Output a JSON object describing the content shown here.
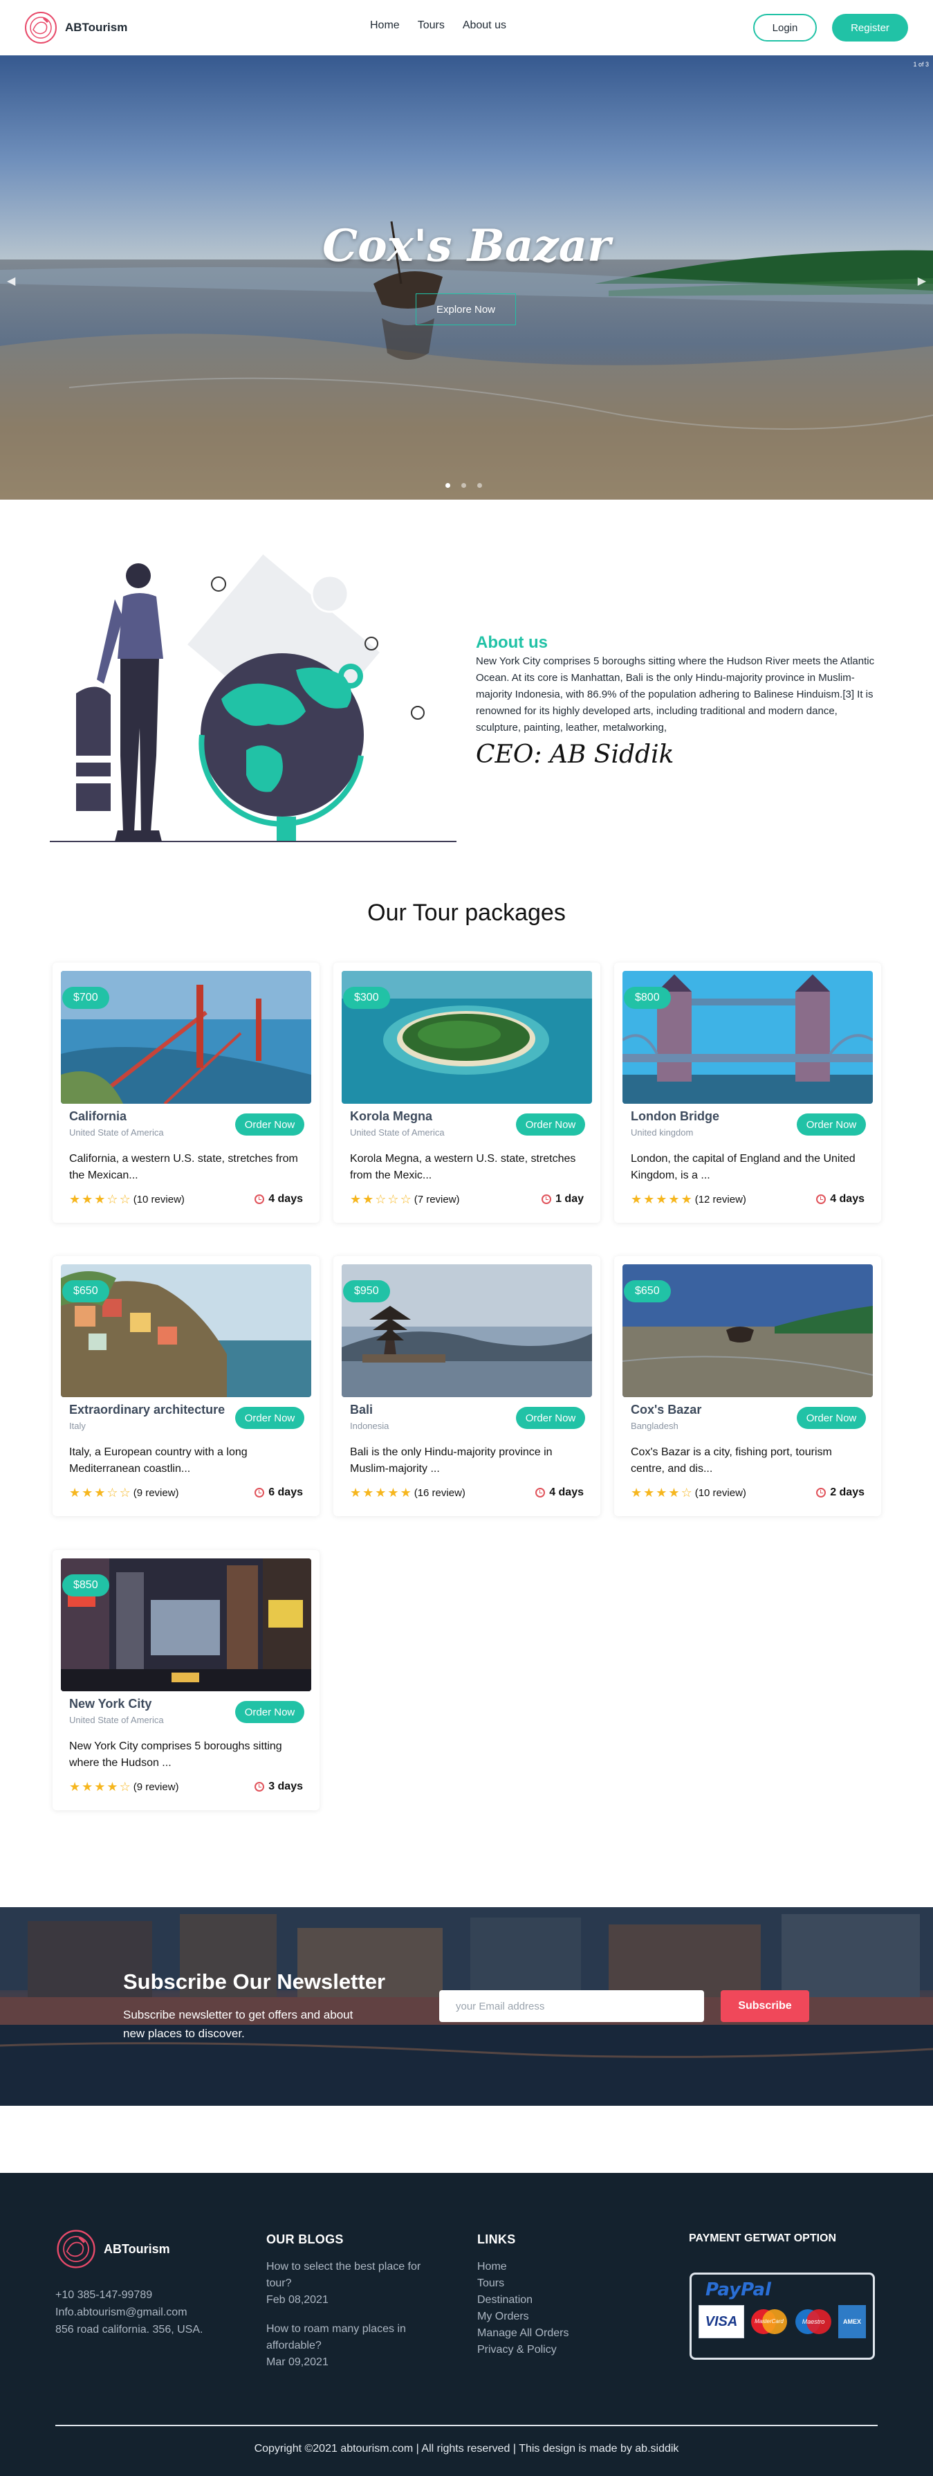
{
  "nav": {
    "brand": "ABTourism",
    "links": [
      "Home",
      "Tours",
      "About us"
    ],
    "login": "Login",
    "register": "Register",
    "colors": {
      "accent": "#21c2a6",
      "brand_logo": "#e84a6a"
    }
  },
  "hero": {
    "counter": "1 of 3",
    "title": "Cox's Bazar",
    "button": "Explore Now",
    "prev_icon": "chevron-left-icon",
    "next_icon": "chevron-right-icon",
    "slides": 3,
    "active_slide": 1
  },
  "about": {
    "title": "About us",
    "text": "New York City comprises 5 boroughs sitting where the Hudson River meets the Atlantic Ocean. At its core is Manhattan, Bali is the only Hindu-majority province in Muslim-majority Indonesia, with 86.9% of the population adhering to Balinese Hinduism.[3] It is renowned for its highly developed arts, including traditional and modern dance, sculpture, painting, leather, metalworking,",
    "ceo": "CEO: AB Siddik"
  },
  "packages": {
    "title": "Our Tour packages",
    "order_label": "Order Now",
    "items": [
      {
        "price": "$700",
        "name": "California",
        "country": "United State of America",
        "desc": "California, a western U.S. state, stretches from the Mexican...",
        "rating": 3,
        "reviews": "(10 review)",
        "days": "4 days",
        "scene": "golden-gate-bridge"
      },
      {
        "price": "$300",
        "name": "Korola Megna",
        "country": "United State of America",
        "desc": "Korola Megna, a western U.S. state, stretches from the Mexic...",
        "rating": 2,
        "reviews": "(7 review)",
        "days": "1 day",
        "scene": "island"
      },
      {
        "price": "$800",
        "name": "London Bridge",
        "country": "United kingdom",
        "desc": "London, the capital of England and the United Kingdom, is a ...",
        "rating": 5,
        "reviews": "(12 review)",
        "days": "4 days",
        "scene": "tower-bridge"
      },
      {
        "price": "$650",
        "name": "Extraordinary architecture",
        "country": "Italy",
        "desc": "Italy, a European country with a long Mediterranean coastlin...",
        "rating": 3,
        "reviews": "(9 review)",
        "days": "6 days",
        "scene": "cliff-village"
      },
      {
        "price": "$950",
        "name": "Bali",
        "country": "Indonesia",
        "desc": "Bali is the only Hindu-majority province in Muslim-majority ...",
        "rating": 5,
        "reviews": "(16 review)",
        "days": "4 days",
        "scene": "temple-lake"
      },
      {
        "price": "$650",
        "name": "Cox's Bazar",
        "country": "Bangladesh",
        "desc": "Cox's Bazar is a city, fishing port, tourism centre, and dis...",
        "rating": 4,
        "reviews": "(10 review)",
        "days": "2 days",
        "scene": "beach-boat"
      },
      {
        "price": "$850",
        "name": "New York City",
        "country": "United State of America",
        "desc": "New York City comprises 5 boroughs sitting where the Hudson ...",
        "rating": 4,
        "reviews": "(9 review)",
        "days": "3 days",
        "scene": "times-square"
      }
    ]
  },
  "newsletter": {
    "title": "Subscribe Our Newsletter",
    "text": "Subscribe newsletter to get offers and about new places to discover.",
    "placeholder": "your Email address",
    "button": "Subscribe"
  },
  "footer": {
    "brand": "ABTourism",
    "phone": "+10 385-147-99789",
    "email": "Info.abtourism@gmail.com",
    "address": "856 road california. 356, USA.",
    "blogs_title": "OUR BLOGS",
    "blogs": [
      {
        "title": "How to select the best place for tour?",
        "date": "Feb 08,2021"
      },
      {
        "title": "How to roam many places in affordable?",
        "date": "Mar 09,2021"
      }
    ],
    "links_title": "LINKS",
    "links": [
      "Home",
      "Tours",
      "Destination",
      "My Orders",
      "Manage All Orders",
      "Privacy & Policy"
    ],
    "payment_title": "PAYMENT GETWAT OPTION",
    "paypal": "PayPal",
    "cards": [
      "VISA",
      "MasterCard",
      "Maestro",
      "AMEX"
    ],
    "copyright": "Copyright ©2021 abtourism.com | All rights reserved | This design is made by ab.siddik"
  }
}
